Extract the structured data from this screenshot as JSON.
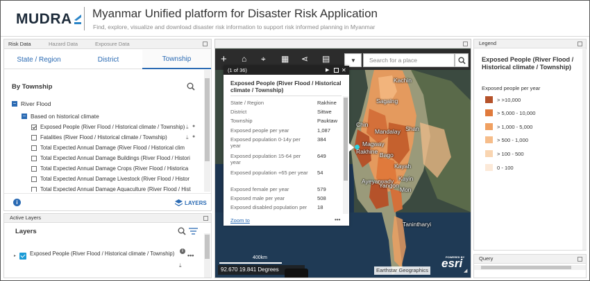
{
  "header": {
    "logo_text": "MUDRA",
    "title": "Myanmar Unified platform for Disaster Risk Application",
    "subtitle": "Find, explore, visualize and download disaster risk information to support risk informed planning in Myanmar"
  },
  "left_panel": {
    "top_tabs": [
      "Risk Data",
      "Hazard Data",
      "Exposure Data"
    ],
    "sub_tabs": [
      "State / Region",
      "District",
      "Township"
    ],
    "section_title": "By Township",
    "tree": {
      "group": "River Flood",
      "subgroup": "Based on historical climate",
      "items": [
        {
          "label": "Exposed People (River Flood / Historical climate / Township)",
          "checked": true
        },
        {
          "label": "Fatalities (River Flood / Historical climate / Township)",
          "checked": false
        },
        {
          "label": "Total Expected Annual Damage (River Flood / Historical clim",
          "checked": false
        },
        {
          "label": "Total Expected Annual Damage Buildings (River Flood / Histori",
          "checked": false
        },
        {
          "label": "Total Expected Annual Damage Crops (River Flood / Historica",
          "checked": false
        },
        {
          "label": "Total Expected Annual Damage Livestock (River Flood / Histor",
          "checked": false
        },
        {
          "label": "Total Expected Annual Damage Aquaculture (River Flood / Hist",
          "checked": false
        }
      ]
    },
    "layers_button": "LAYERS"
  },
  "active_layers": {
    "header": "Active Layers",
    "title": "Layers",
    "item_label": "Exposed People (River Flood / Historical climate / Township)"
  },
  "map": {
    "search_placeholder": "Search for a place",
    "popup": {
      "counter": "(1 of 36)",
      "title": "Exposed People (River Flood / Historical climate / Township)",
      "rows": [
        {
          "label": "State / Region",
          "value": "Rakhine"
        },
        {
          "label": "District",
          "value": "Sittwe"
        },
        {
          "label": "Township",
          "value": "Pauktaw"
        },
        {
          "label": "Exposed people per year",
          "value": "1,087"
        },
        {
          "label": "Exposed population 0-14y per year",
          "value": "384"
        },
        {
          "label": "Exposed population 15-64 per year",
          "value": "649"
        },
        {
          "label": "Exposed population +65 per year",
          "value": "54"
        },
        {
          "label": "Exposed female per year",
          "value": "579"
        },
        {
          "label": "Exposed male per year",
          "value": "508"
        },
        {
          "label": "Exposed disabled population per year",
          "value": "18"
        }
      ],
      "zoom_link": "Zoom to"
    },
    "labels": [
      "Kachin",
      "Sagaing",
      "Chin",
      "Mandalay",
      "Shan",
      "Magway",
      "Rakhine",
      "Bago",
      "Kayah",
      "Ayeyarwady",
      "Kayin",
      "Yangon",
      "Mon",
      "Tanintharyi"
    ],
    "scale": "400km",
    "coords": "92.670 19.841 Degrees",
    "attribution": "Earthstar Geographics",
    "esri_powered": "POWERED BY",
    "esri_text": "esri"
  },
  "legend": {
    "header": "Legend",
    "title": "Exposed People (River Flood / Historical climate / Township)",
    "subtitle": "Exposed people per year",
    "items": [
      {
        "label": "> >10,000",
        "color": "#b5522a"
      },
      {
        "label": "> 5,000 - 10,000",
        "color": "#e07a3c"
      },
      {
        "label": "> 1,000 - 5,000",
        "color": "#f0a061"
      },
      {
        "label": "> 500 - 1,000",
        "color": "#f6bd8a"
      },
      {
        "label": "> 100 - 500",
        "color": "#f9d5b1"
      },
      {
        "label": "0 - 100",
        "color": "#fce9d8"
      }
    ]
  },
  "query": {
    "header": "Query"
  }
}
